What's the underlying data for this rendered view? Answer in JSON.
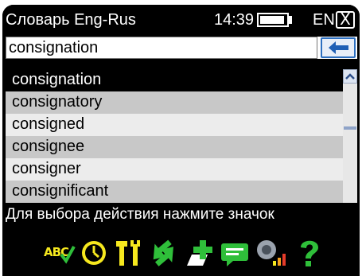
{
  "titlebar": {
    "title": "Словарь Eng-Rus",
    "time": "14:39",
    "language": "EN",
    "close_glyph": "X"
  },
  "search": {
    "value": "consignation"
  },
  "word_list": {
    "items": [
      "consignation",
      "consignatory",
      "consigned",
      "consignee",
      "consigner",
      "consignificant"
    ],
    "selected_index": 0
  },
  "hint": "Для выбора действия нажмите значок",
  "toolbar": {
    "abc_label": "ABC",
    "icons": [
      "spellcheck-icon",
      "clock-icon",
      "tools-icon",
      "sync-icon",
      "add-entry-icon",
      "message-icon",
      "speaker-icon",
      "help-icon"
    ]
  },
  "colors": {
    "background": "#000000",
    "selected_row": "#000000",
    "alt_row": "#c8c8c8",
    "plain_row": "#ececec",
    "accent_blue": "#2d6fc0",
    "icon_yellow": "#f6e81e",
    "icon_green": "#2fbf3a"
  }
}
